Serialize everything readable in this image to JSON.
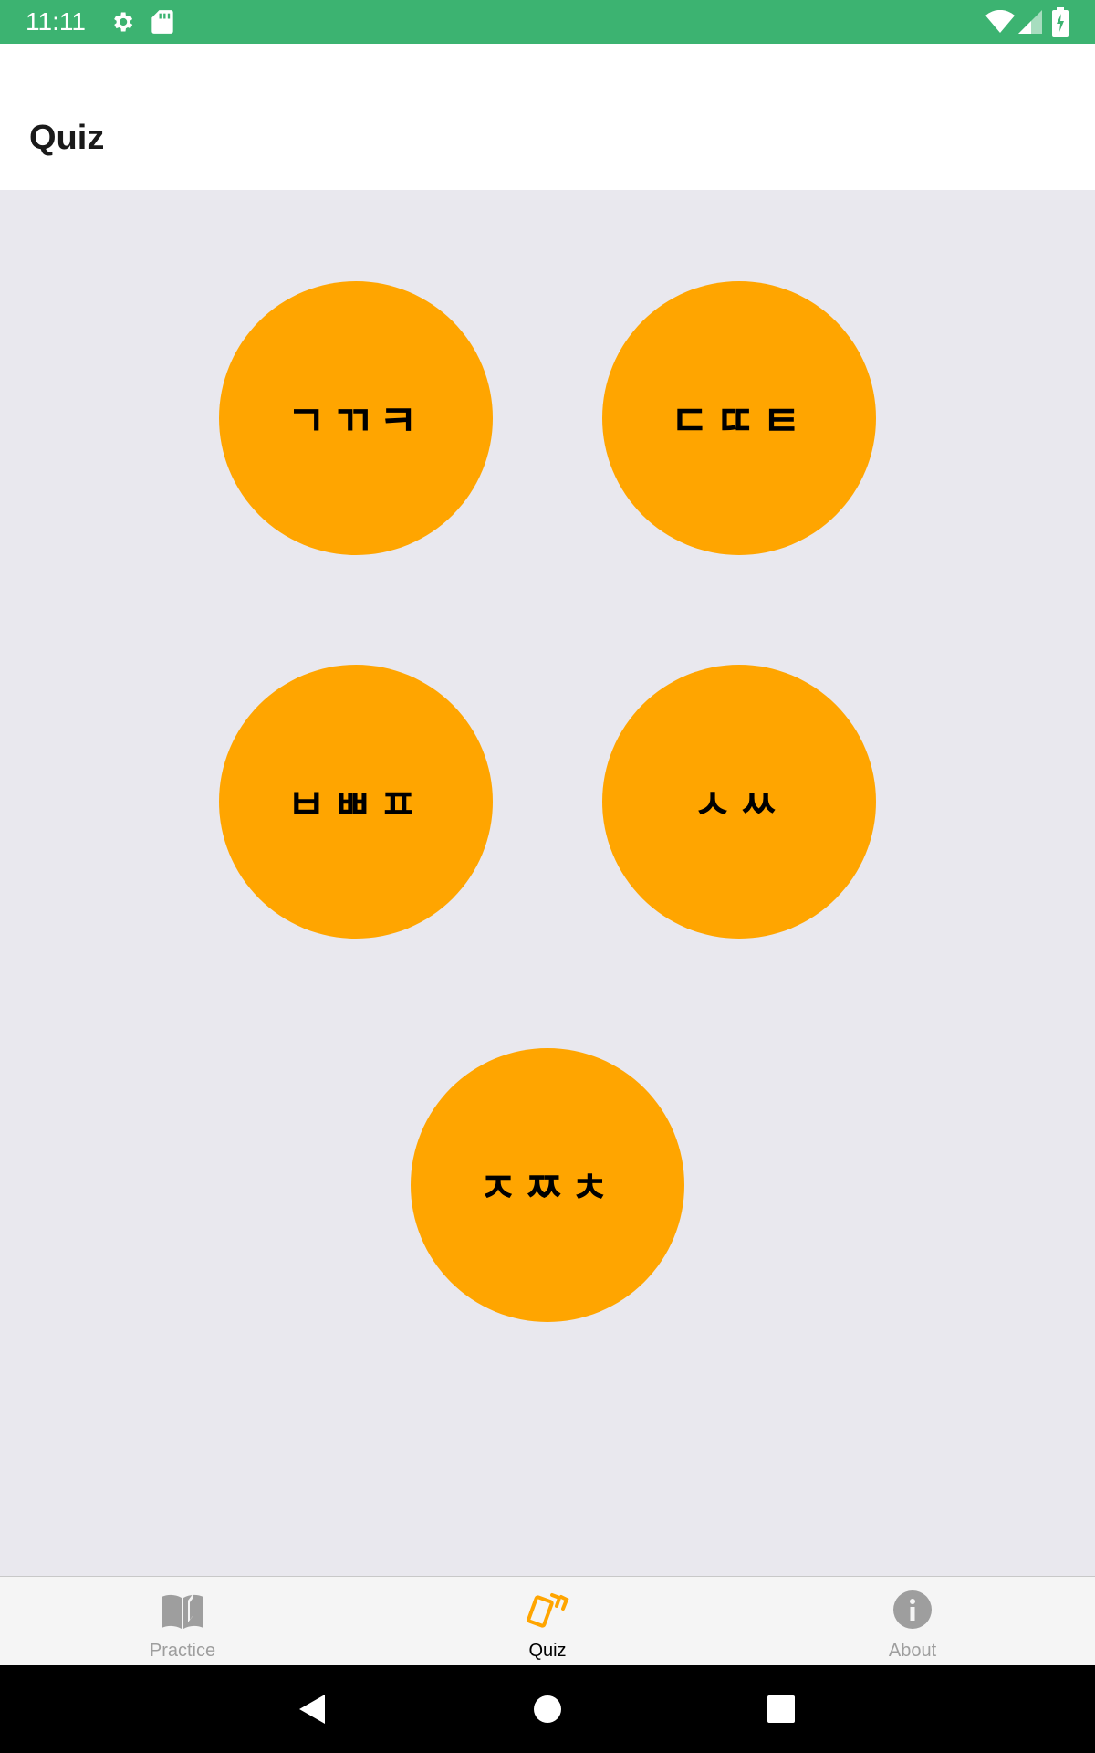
{
  "status_bar": {
    "time": "11:11",
    "icons": [
      "gear-icon",
      "sd-card-icon",
      "wifi-icon",
      "signal-icon",
      "battery-charging-icon"
    ],
    "background_color": "#3cb371"
  },
  "app_bar": {
    "title": "Quiz"
  },
  "quiz": {
    "accent_color": "#ffa500",
    "groups": [
      {
        "label": "ㄱㄲㅋ"
      },
      {
        "label": "ㄷㄸㅌ"
      },
      {
        "label": "ㅂㅃㅍ"
      },
      {
        "label": "ㅅㅆ"
      },
      {
        "label": "ㅈㅉㅊ"
      }
    ]
  },
  "bottom_nav": {
    "items": [
      {
        "label": "Practice",
        "icon": "book-icon",
        "active": false
      },
      {
        "label": "Quiz",
        "icon": "cards-icon",
        "active": true
      },
      {
        "label": "About",
        "icon": "info-icon",
        "active": false
      }
    ]
  },
  "system_nav": {
    "buttons": [
      "back-icon",
      "home-icon",
      "recents-icon"
    ]
  }
}
